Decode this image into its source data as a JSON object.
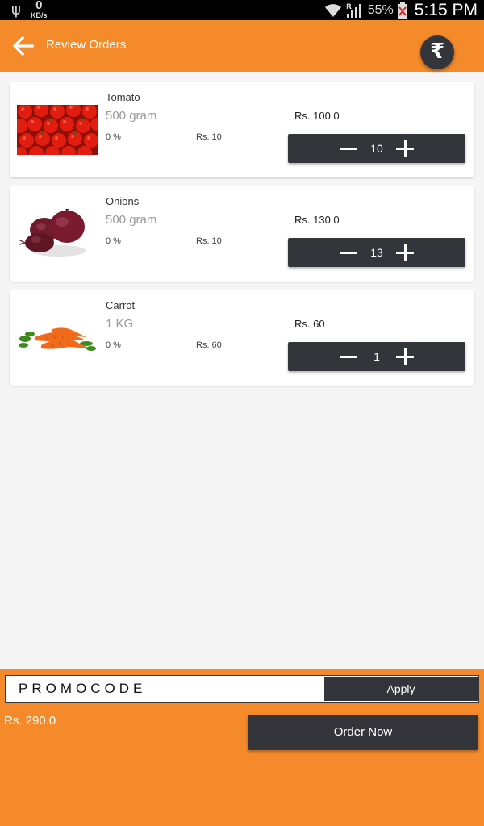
{
  "status_bar": {
    "speed_value": "0",
    "speed_unit": "KB/s",
    "network_type": "R",
    "battery": "55%",
    "time": "5:15 PM"
  },
  "header": {
    "title": "Review Orders",
    "currency_symbol": "₹"
  },
  "items": [
    {
      "name": "Tomato",
      "weight": "500 gram",
      "discount": "0 %",
      "unit_price": "Rs. 10",
      "total": "Rs. 100.0",
      "quantity": "10",
      "image": "tomato-image"
    },
    {
      "name": "Onions",
      "weight": "500 gram",
      "discount": "0 %",
      "unit_price": "Rs. 10",
      "total": "Rs. 130.0",
      "quantity": "13",
      "image": "onion-image"
    },
    {
      "name": "Carrot",
      "weight": "1 KG",
      "discount": "0 %",
      "unit_price": "Rs. 60",
      "total": "Rs. 60",
      "quantity": "1",
      "image": "carrot-image"
    }
  ],
  "footer": {
    "promo_placeholder": "PROMOCODE",
    "apply_label": "Apply",
    "grand_total": "Rs. 290.0",
    "order_label": "Order Now"
  },
  "colors": {
    "accent": "#f58a2a",
    "dark": "#33353b",
    "background": "#f5f5f5"
  }
}
